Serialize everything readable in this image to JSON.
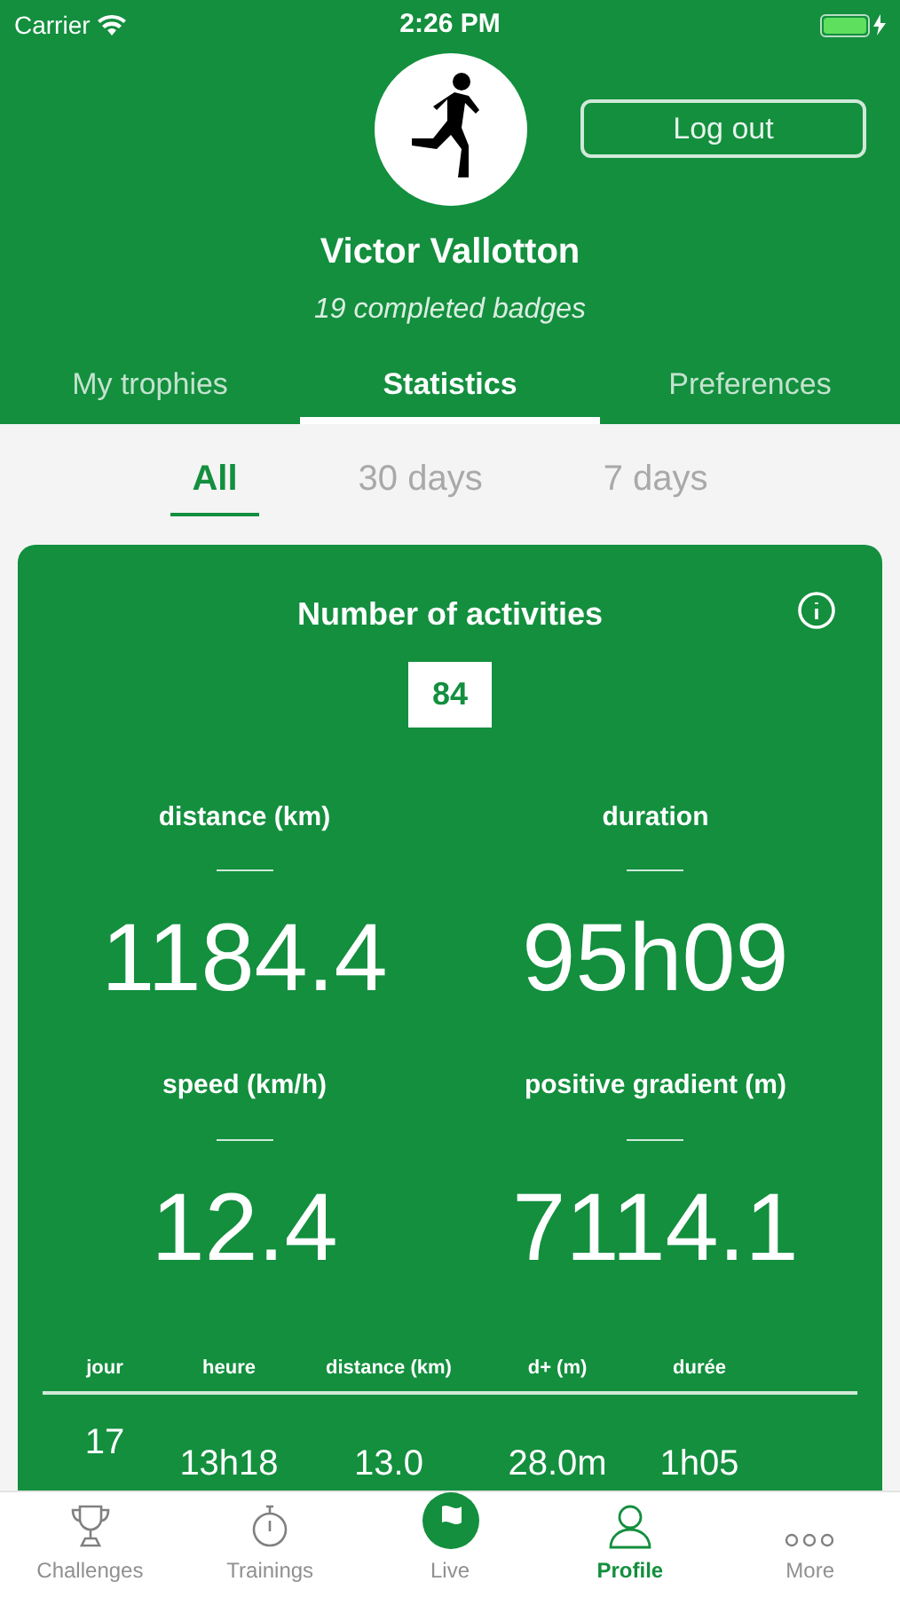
{
  "status_bar": {
    "carrier": "Carrier",
    "time": "2:26 PM"
  },
  "profile": {
    "name": "Victor Vallotton",
    "subtitle": "19 completed badges",
    "logout": "Log out"
  },
  "tabs": [
    {
      "label": "My trophies",
      "selected": false
    },
    {
      "label": "Statistics",
      "selected": true
    },
    {
      "label": "Preferences",
      "selected": false
    }
  ],
  "periods": [
    {
      "label": "All",
      "selected": true
    },
    {
      "label": "30 days",
      "selected": false
    },
    {
      "label": "7 days",
      "selected": false
    }
  ],
  "card": {
    "title": "Number of activities",
    "count": "84",
    "stats": [
      {
        "label": "distance (km)",
        "value": "1184.4"
      },
      {
        "label": "duration",
        "value": "95h09"
      },
      {
        "label": "speed (km/h)",
        "value": "12.4"
      },
      {
        "label": "positive gradient (m)",
        "value": "7114.1"
      }
    ],
    "table": {
      "columns": [
        "jour",
        "heure",
        "distance (km)",
        "d+ (m)",
        "durée"
      ],
      "rows": [
        [
          "17",
          "13h18",
          "13.0",
          "28.0m",
          "1h05"
        ]
      ]
    }
  },
  "tab_bar": [
    {
      "label": "Challenges",
      "selected": false
    },
    {
      "label": "Trainings",
      "selected": false
    },
    {
      "label": "Live",
      "selected": false
    },
    {
      "label": "Profile",
      "selected": true
    },
    {
      "label": "More",
      "selected": false
    }
  ]
}
